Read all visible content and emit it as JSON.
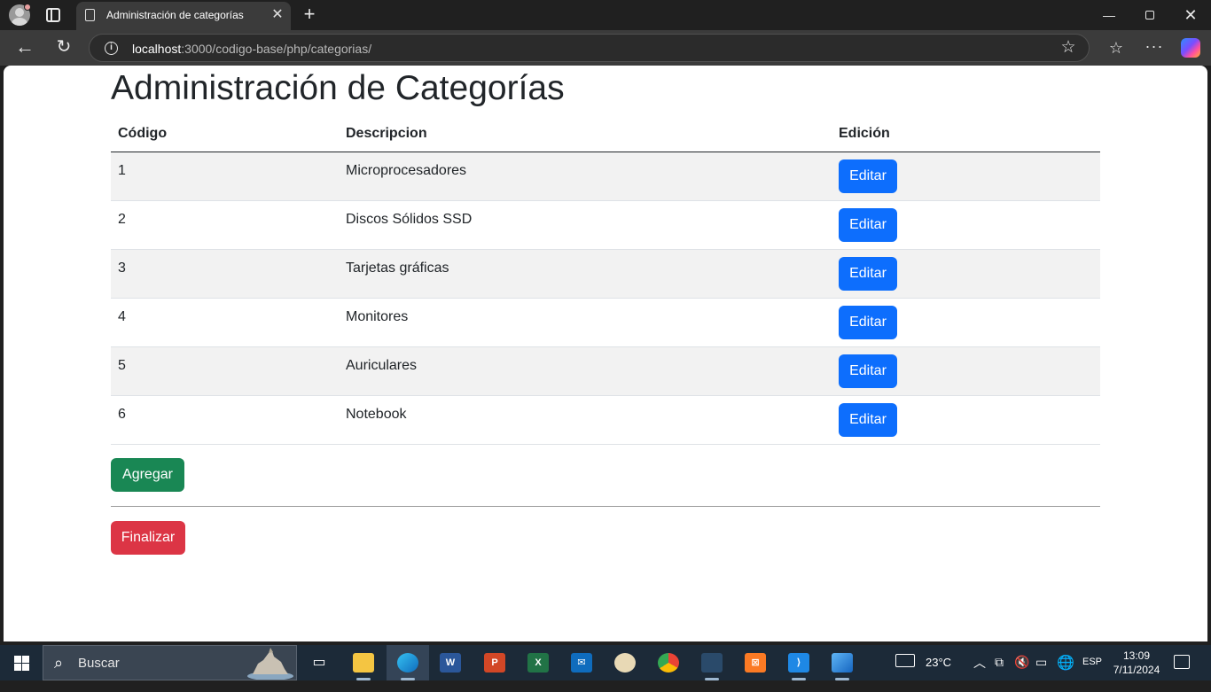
{
  "browser": {
    "tab_title": "Administración de categorías",
    "url_host": "localhost",
    "url_rest": ":3000/codigo-base/php/categorias/"
  },
  "page": {
    "title": "Administración de Categorías",
    "columns": [
      "Código",
      "Descripcion",
      "Edición"
    ],
    "rows": [
      {
        "code": "1",
        "description": "Microprocesadores",
        "action": "Editar"
      },
      {
        "code": "2",
        "description": "Discos Sólidos SSD",
        "action": "Editar"
      },
      {
        "code": "3",
        "description": "Tarjetas gráficas",
        "action": "Editar"
      },
      {
        "code": "4",
        "description": "Monitores",
        "action": "Editar"
      },
      {
        "code": "5",
        "description": "Auriculares",
        "action": "Editar"
      },
      {
        "code": "6",
        "description": "Notebook",
        "action": "Editar"
      }
    ],
    "add_label": "Agregar",
    "finish_label": "Finalizar"
  },
  "taskbar": {
    "search_placeholder": "Buscar",
    "weather": "23°C",
    "language": "ESP",
    "time": "13:09",
    "date": "7/11/2024"
  },
  "colors": {
    "primary": "#0d6efd",
    "success": "#198754",
    "danger": "#dc3545"
  }
}
